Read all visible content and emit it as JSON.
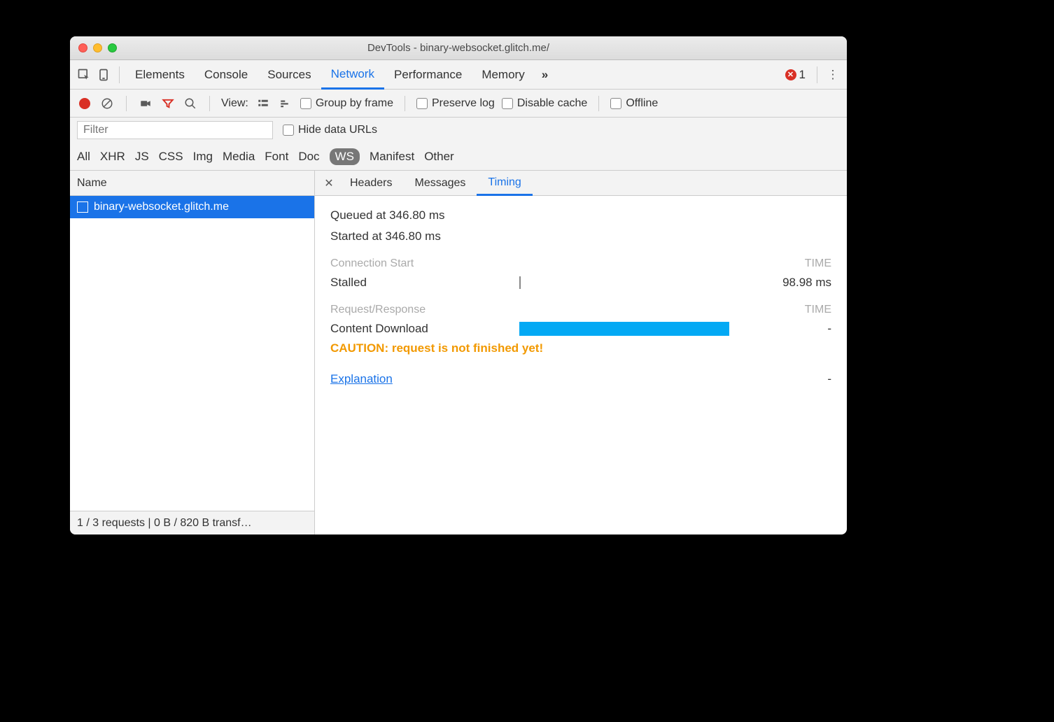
{
  "window": {
    "title": "DevTools - binary-websocket.glitch.me/"
  },
  "tabs": {
    "items": [
      "Elements",
      "Console",
      "Sources",
      "Network",
      "Performance",
      "Memory"
    ],
    "active": "Network",
    "more_glyph": "»",
    "error_count": "1"
  },
  "toolbar": {
    "view_label": "View:",
    "group_by_frame": "Group by frame",
    "preserve_log": "Preserve log",
    "disable_cache": "Disable cache",
    "offline": "Offline"
  },
  "filterbar": {
    "filter_placeholder": "Filter",
    "hide_data_urls": "Hide data URLs"
  },
  "types": {
    "items": [
      "All",
      "XHR",
      "JS",
      "CSS",
      "Img",
      "Media",
      "Font",
      "Doc",
      "WS",
      "Manifest",
      "Other"
    ],
    "active": "WS"
  },
  "name_column": {
    "header": "Name",
    "rows": [
      {
        "label": "binary-websocket.glitch.me",
        "selected": true
      }
    ],
    "footer": "1 / 3 requests | 0 B / 820 B transf…"
  },
  "detail": {
    "tabs": [
      "Headers",
      "Messages",
      "Timing"
    ],
    "active": "Timing",
    "queued": "Queued at 346.80 ms",
    "started": "Started at 346.80 ms",
    "section_conn": "Connection Start",
    "time_header": "TIME",
    "stalled_label": "Stalled",
    "stalled_value": "98.98 ms",
    "section_req": "Request/Response",
    "content_dl_label": "Content Download",
    "content_dl_value": "-",
    "caution": "CAUTION: request is not finished yet!",
    "explanation": "Explanation",
    "explanation_value": "-"
  }
}
